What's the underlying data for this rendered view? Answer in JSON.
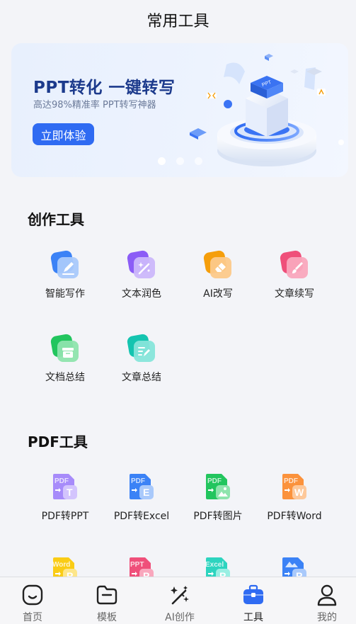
{
  "header": {
    "title": "常用工具"
  },
  "banner": {
    "title": "PPT转化 一键转写",
    "subtitle": "高达98%精准率 PPT转写神器",
    "button_label": "立即体验",
    "art_badge": "PPT",
    "slide_count": 3,
    "active_slide": 1
  },
  "creation": {
    "title": "创作工具",
    "items": [
      {
        "label": "智能写作",
        "icon": "pencil-icon",
        "color": "#3b82f6"
      },
      {
        "label": "文本润色",
        "icon": "magic-wand-icon",
        "color": "#8b5cf6"
      },
      {
        "label": "AI改写",
        "icon": "eraser-icon",
        "color": "#f59e0b"
      },
      {
        "label": "文章续写",
        "icon": "brush-icon",
        "color": "#ef4f7a"
      },
      {
        "label": "文档总结",
        "icon": "archive-icon",
        "color": "#22c55e"
      },
      {
        "label": "文章总结",
        "icon": "edit-list-icon",
        "color": "#14c4b0"
      }
    ]
  },
  "pdf": {
    "title": "PDF工具",
    "items": [
      {
        "label": "PDF转PPT",
        "icon": "pdf-to-ppt-icon",
        "tag": "PDF",
        "letter": "T",
        "color": "#a78bfa"
      },
      {
        "label": "PDF转Excel",
        "icon": "pdf-to-excel-icon",
        "tag": "PDF",
        "letter": "E",
        "color": "#3b82f6"
      },
      {
        "label": "PDF转图片",
        "icon": "pdf-to-image-icon",
        "tag": "PDF",
        "letter": "",
        "color": "#22c55e"
      },
      {
        "label": "PDF转Word",
        "icon": "pdf-to-word-icon",
        "tag": "PDF",
        "letter": "W",
        "color": "#fb923c"
      }
    ],
    "more_items": [
      {
        "icon": "word-to-pdf-icon",
        "tag": "Word",
        "letter": "P",
        "color": "#facc15"
      },
      {
        "icon": "ppt-to-pdf-icon",
        "tag": "PPT",
        "letter": "P",
        "color": "#ef4f7a"
      },
      {
        "icon": "excel-to-pdf-icon",
        "tag": "Excel",
        "letter": "P",
        "color": "#2dd4bf"
      },
      {
        "icon": "image-to-pdf-icon",
        "tag": "",
        "letter": "P",
        "color": "#3b82f6"
      }
    ]
  },
  "tabbar": {
    "items": [
      {
        "label": "首页",
        "icon": "home-icon"
      },
      {
        "label": "模板",
        "icon": "folder-icon"
      },
      {
        "label": "AI创作",
        "icon": "ai-wand-icon"
      },
      {
        "label": "工具",
        "icon": "toolbox-icon",
        "active": true,
        "color": "#2f6bf2"
      },
      {
        "label": "我的",
        "icon": "profile-icon"
      }
    ]
  }
}
